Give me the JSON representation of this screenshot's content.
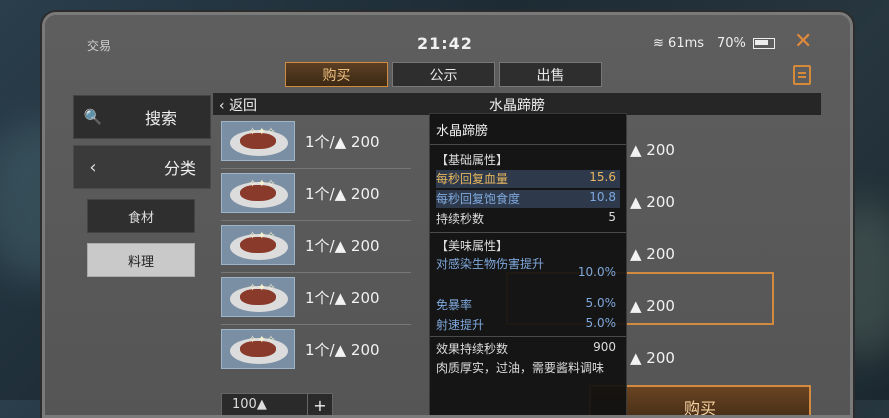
{
  "header": {
    "window_title": "交易",
    "clock": "21:42",
    "ping": "61ms",
    "battery": "70%"
  },
  "tabs": [
    {
      "label": "购买",
      "active": true
    },
    {
      "label": "公示",
      "active": false
    },
    {
      "label": "出售",
      "active": false
    }
  ],
  "sidebar": {
    "search_label": "搜索",
    "category_label": "分类",
    "subcats": [
      {
        "label": "食材",
        "selected": false
      },
      {
        "label": "料理",
        "selected": true
      }
    ]
  },
  "breadcrumb": {
    "back_label": "返回",
    "title": "水晶蹄膀"
  },
  "listings_left": [
    {
      "price": "1个/▲ 200"
    },
    {
      "price": "1个/▲ 200"
    },
    {
      "price": "1个/▲ 200"
    },
    {
      "price": "1个/▲ 200"
    },
    {
      "price": "1个/▲ 200"
    }
  ],
  "listings_right": [
    {
      "price": "▲ 200"
    },
    {
      "price": "▲ 200"
    },
    {
      "price": "▲ 200"
    },
    {
      "price": "▲ 200"
    },
    {
      "price": "▲ 200"
    }
  ],
  "tooltip": {
    "item_name": "水晶蹄膀",
    "basic_section": "【基础属性】",
    "basic_attrs": [
      {
        "name": "每秒回复血量",
        "value": "15.6",
        "color": "#e6b65c"
      },
      {
        "name": "每秒回复饱食度",
        "value": "10.8",
        "color": "#7fa8dc"
      },
      {
        "name": "持续秒数",
        "value": "5",
        "color": "#dddddd"
      }
    ],
    "flavor_section": "【美味属性】",
    "flavor_attrs": [
      {
        "name": "对感染生物伤害提升",
        "value": "10.0%",
        "color": "#7fa8dc"
      },
      {
        "name": "免暴率",
        "value": "5.0%",
        "color": "#7fa8dc"
      },
      {
        "name": "射速提升",
        "value": "5.0%",
        "color": "#7fa8dc"
      },
      {
        "name": "效果持续秒数",
        "value": "900",
        "color": "#dddddd"
      }
    ],
    "description": "肉质厚实，过油，需要酱料调味"
  },
  "buy_button": "购买",
  "quantity": "100▲"
}
